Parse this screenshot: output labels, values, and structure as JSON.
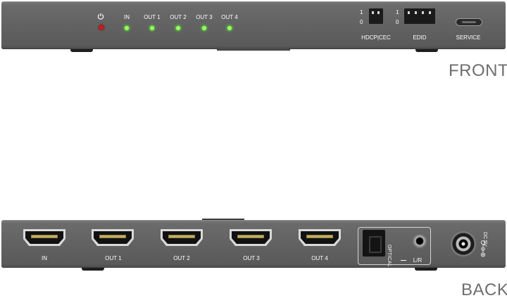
{
  "front": {
    "side_label": "FRONT",
    "leds": {
      "power_icon": "power-icon",
      "in": "IN",
      "out1": "OUT 1",
      "out2": "OUT 2",
      "out3": "OUT 3",
      "out4": "OUT 4"
    },
    "hdcp_cec": {
      "label": "HDCP|CEC",
      "one": "1",
      "zero": "0"
    },
    "edid": {
      "label": "EDID",
      "one": "1",
      "zero": "0"
    },
    "service": {
      "label": "SERVICE"
    }
  },
  "back": {
    "side_label": "BACK",
    "ports": {
      "in": "IN",
      "out1": "OUT 1",
      "out2": "OUT 2",
      "out3": "OUT 3",
      "out4": "OUT 4"
    },
    "optical": "OPTICAL",
    "lr": "L/R",
    "dc": "DC 5V"
  },
  "colors": {
    "chassis": "#626262",
    "led_green": "#9bff6a",
    "led_red": "#d81818",
    "label_text": "#ffffff",
    "side_label_text": "#6e6e6e"
  }
}
